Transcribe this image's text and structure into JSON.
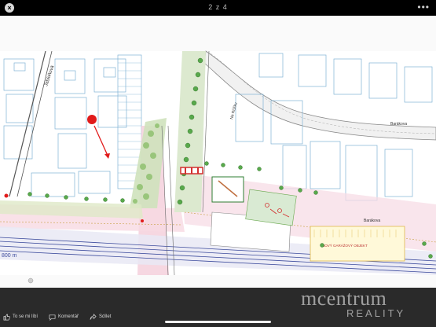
{
  "viewer": {
    "counter": "2 z 4",
    "close_label": "×",
    "more_label": "•••"
  },
  "actions": [
    {
      "label": "To se mi líbí",
      "icon": "thumbs-up-icon"
    },
    {
      "label": "Komentář",
      "icon": "comment-icon"
    },
    {
      "label": "Sdílet",
      "icon": "share-icon"
    }
  ],
  "map": {
    "street_labels": [
      "Jabloňová",
      "Na Růžku",
      "Barákova",
      "Barákova"
    ],
    "building_label": "NOVÝ GARÁŽOVÝ OBJEKT",
    "scale_label": "800 m",
    "pin_color": "#e11b1b",
    "arrow_color": "#e11b1b"
  },
  "watermark": {
    "logo": "mcentrum",
    "subtitle": "REALITY"
  }
}
